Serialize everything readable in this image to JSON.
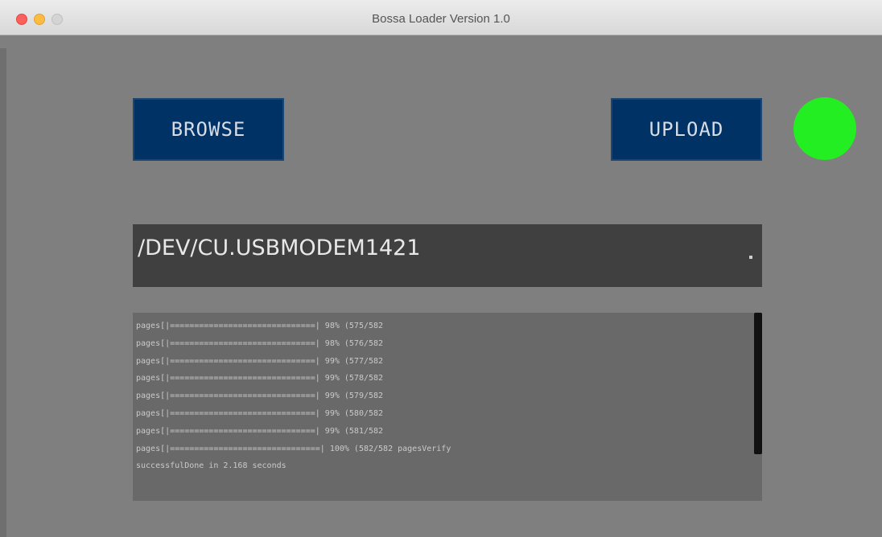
{
  "window": {
    "title": "Bossa Loader Version 1.0"
  },
  "toolbar": {
    "browse_label": "BROWSE",
    "upload_label": "UPLOAD"
  },
  "status": {
    "connected_color": "#22ee22"
  },
  "port": {
    "selected": "/DEV/CU.USBMODEM1421"
  },
  "console": {
    "lines": [
      "pages[|==============================| 98% (575/582",
      "pages[|==============================| 98% (576/582",
      "pages[|==============================| 99% (577/582",
      "pages[|==============================| 99% (578/582",
      "pages[|==============================| 99% (579/582",
      "pages[|==============================| 99% (580/582",
      "pages[|==============================| 99% (581/582",
      "pages[|===============================| 100% (582/582 pagesVerify",
      "successfulDone in 2.168 seconds"
    ]
  }
}
